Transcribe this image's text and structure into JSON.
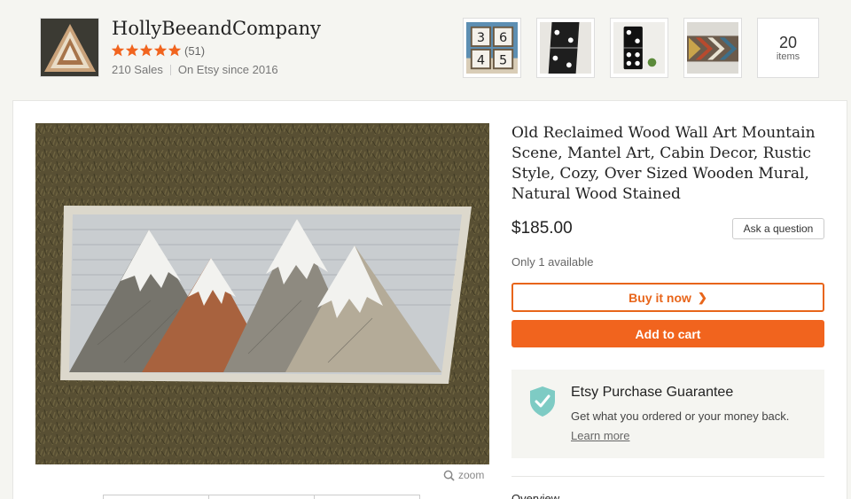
{
  "shop": {
    "name": "HollyBeeandCompany",
    "rating": 5,
    "rating_count": "(51)",
    "sales": "210 Sales",
    "since": "On Etsy since 2016",
    "items_count": "20",
    "items_label": "items",
    "thumbnails": [
      "number-tiles-photo",
      "domino-photo-1",
      "domino-photo-2",
      "chevron-art-photo"
    ]
  },
  "listing": {
    "title": "Old Reclaimed Wood Wall Art Mountain Scene, Mantel Art, Cabin Decor, Rustic Style, Cozy, Over Sized Wooden Mural, Natural Wood Stained",
    "price": "$185.00",
    "ask_label": "Ask a question",
    "availability": "Only 1 available",
    "buy_label": "Buy it now",
    "cart_label": "Add to cart",
    "zoom_label": "zoom",
    "overview_label": "Overview"
  },
  "guarantee": {
    "title": "Etsy Purchase Guarantee",
    "text": "Get what you ordered or your money back.",
    "link": "Learn more"
  },
  "colors": {
    "accent": "#f1641e",
    "star": "#f1641e",
    "shield": "#7ecbc4"
  }
}
